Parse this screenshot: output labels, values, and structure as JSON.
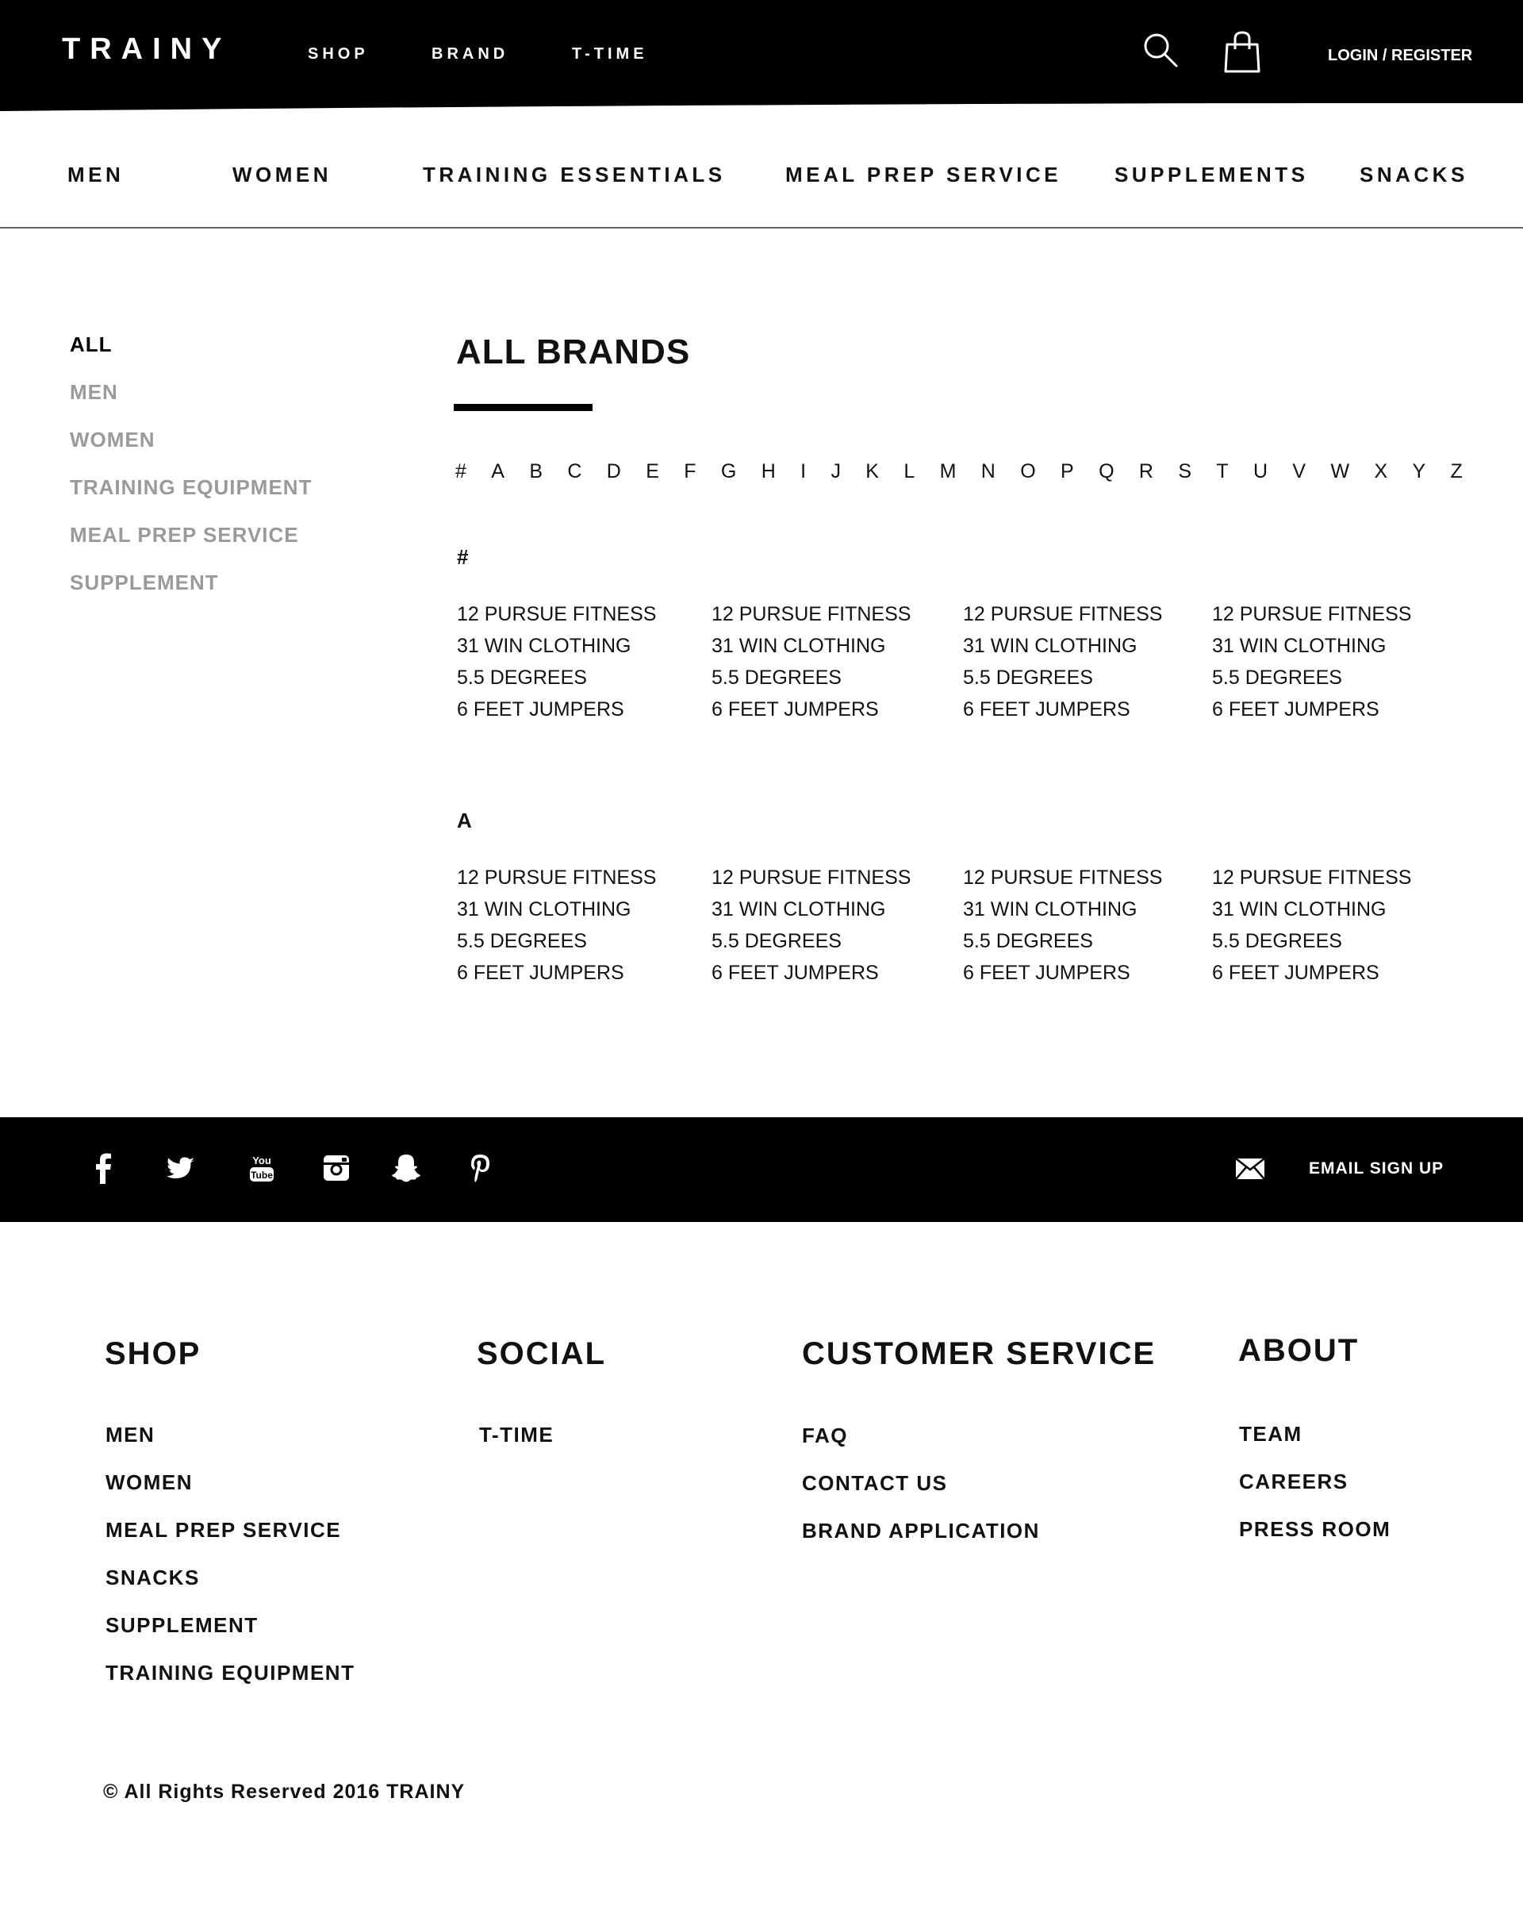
{
  "header": {
    "logo": "TRAINY",
    "nav": [
      "SHOP",
      "BRAND",
      "T-TIME"
    ],
    "icons": [
      "search-icon",
      "shopping-bag-icon"
    ],
    "login": "LOGIN / REGISTER"
  },
  "categories": [
    "MEN",
    "WOMEN",
    "TRAINING ESSENTIALS",
    "MEAL PREP SERVICE",
    "SUPPLEMENTS",
    "SNACKS"
  ],
  "sidebar": {
    "items": [
      {
        "label": "ALL",
        "active": true
      },
      {
        "label": "MEN",
        "active": false
      },
      {
        "label": "WOMEN",
        "active": false
      },
      {
        "label": "TRAINING EQUIPMENT",
        "active": false
      },
      {
        "label": "MEAL PREP SERVICE",
        "active": false
      },
      {
        "label": "SUPPLEMENT",
        "active": false
      }
    ]
  },
  "main": {
    "title": "ALL BRANDS",
    "alphabet": [
      "#",
      "A",
      "B",
      "C",
      "D",
      "E",
      "F",
      "G",
      "H",
      "I",
      "J",
      "K",
      "L",
      "M",
      "N",
      "O",
      "P",
      "Q",
      "R",
      "S",
      "T",
      "U",
      "V",
      "W",
      "X",
      "Y",
      "Z"
    ],
    "sections": [
      {
        "letter": "#",
        "columns": [
          [
            "12 PURSUE FITNESS",
            "31 WIN CLOTHING",
            "5.5 DEGREES",
            "6 FEET JUMPERS"
          ],
          [
            "12 PURSUE FITNESS",
            "31 WIN CLOTHING",
            "5.5 DEGREES",
            "6 FEET JUMPERS"
          ],
          [
            "12 PURSUE FITNESS",
            "31 WIN CLOTHING",
            "5.5 DEGREES",
            "6 FEET JUMPERS"
          ],
          [
            "12 PURSUE FITNESS",
            "31 WIN CLOTHING",
            "5.5 DEGREES",
            "6 FEET JUMPERS"
          ]
        ]
      },
      {
        "letter": "A",
        "columns": [
          [
            "12 PURSUE FITNESS",
            "31 WIN CLOTHING",
            "5.5 DEGREES",
            "6 FEET JUMPERS"
          ],
          [
            "12 PURSUE FITNESS",
            "31 WIN CLOTHING",
            "5.5 DEGREES",
            "6 FEET JUMPERS"
          ],
          [
            "12 PURSUE FITNESS",
            "31 WIN CLOTHING",
            "5.5 DEGREES",
            "6 FEET JUMPERS"
          ],
          [
            "12 PURSUE FITNESS",
            "31 WIN CLOTHING",
            "5.5 DEGREES",
            "6 FEET JUMPERS"
          ]
        ]
      }
    ]
  },
  "social": {
    "icons": [
      "facebook-icon",
      "twitter-icon",
      "youtube-icon",
      "instagram-icon",
      "snapchat-icon",
      "pinterest-icon"
    ],
    "youtube_text_top": "You",
    "youtube_text_bottom": "Tube",
    "email_signup": "EMAIL SIGN UP"
  },
  "footer": {
    "columns": [
      {
        "heading": "SHOP",
        "links": [
          "MEN",
          "WOMEN",
          "MEAL PREP SERVICE",
          "SNACKS",
          "SUPPLEMENT",
          "TRAINING EQUIPMENT"
        ]
      },
      {
        "heading": "SOCIAL",
        "links": [
          "T-TIME"
        ]
      },
      {
        "heading": "CUSTOMER SERVICE",
        "links": [
          "FAQ",
          "CONTACT US",
          "BRAND APPLICATION"
        ]
      },
      {
        "heading": "ABOUT",
        "links": [
          "TEAM",
          "CAREERS",
          "PRESS ROOM"
        ]
      }
    ],
    "copyright": "© All Rights Reserved 2016 TRAINY"
  },
  "colors": {
    "bar": "#000000",
    "text": "#111111",
    "inactive": "#9a9a9a",
    "rule": "#666666"
  }
}
